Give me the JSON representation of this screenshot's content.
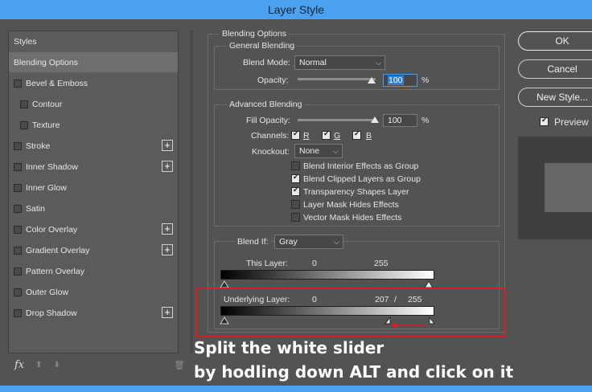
{
  "window": {
    "title": "Layer Style"
  },
  "styles_panel": {
    "items": [
      {
        "label": "Styles",
        "checkbox": false,
        "plus": false,
        "active": false,
        "indent": false
      },
      {
        "label": "Blending Options",
        "checkbox": false,
        "plus": false,
        "active": true,
        "indent": false
      },
      {
        "label": "Bevel & Emboss",
        "checkbox": true,
        "plus": false,
        "active": false,
        "indent": false
      },
      {
        "label": "Contour",
        "checkbox": true,
        "plus": false,
        "active": false,
        "indent": true
      },
      {
        "label": "Texture",
        "checkbox": true,
        "plus": false,
        "active": false,
        "indent": true
      },
      {
        "label": "Stroke",
        "checkbox": true,
        "plus": true,
        "active": false,
        "indent": false
      },
      {
        "label": "Inner Shadow",
        "checkbox": true,
        "plus": true,
        "active": false,
        "indent": false
      },
      {
        "label": "Inner Glow",
        "checkbox": true,
        "plus": false,
        "active": false,
        "indent": false
      },
      {
        "label": "Satin",
        "checkbox": true,
        "plus": false,
        "active": false,
        "indent": false
      },
      {
        "label": "Color Overlay",
        "checkbox": true,
        "plus": true,
        "active": false,
        "indent": false
      },
      {
        "label": "Gradient Overlay",
        "checkbox": true,
        "plus": true,
        "active": false,
        "indent": false
      },
      {
        "label": "Pattern Overlay",
        "checkbox": true,
        "plus": false,
        "active": false,
        "indent": false
      },
      {
        "label": "Outer Glow",
        "checkbox": true,
        "plus": false,
        "active": false,
        "indent": false
      },
      {
        "label": "Drop Shadow",
        "checkbox": true,
        "plus": true,
        "active": false,
        "indent": false
      }
    ],
    "footer": {
      "fx": "fx",
      "up": "⬆",
      "down": "⬇",
      "trash": "🗑"
    }
  },
  "blending_options": {
    "title": "Blending Options",
    "general": {
      "legend": "General Blending",
      "blend_mode_label": "Blend Mode:",
      "blend_mode_value": "Normal",
      "opacity_label": "Opacity:",
      "opacity_value": "100",
      "opacity_fraction": 1.0,
      "percent": "%"
    },
    "advanced": {
      "legend": "Advanced Blending",
      "fill_opacity_label": "Fill Opacity:",
      "fill_opacity_value": "100",
      "fill_opacity_fraction": 1.0,
      "percent": "%",
      "channels_label": "Channels:",
      "channels": [
        {
          "label": "R",
          "checked": true
        },
        {
          "label": "G",
          "checked": true
        },
        {
          "label": "B",
          "checked": true
        }
      ],
      "knockout_label": "Knockout:",
      "knockout_value": "None",
      "options": [
        {
          "label": "Blend Interior Effects as Group",
          "checked": false
        },
        {
          "label": "Blend Clipped Layers as Group",
          "checked": true
        },
        {
          "label": "Transparency Shapes Layer",
          "checked": true
        },
        {
          "label": "Layer Mask Hides Effects",
          "checked": false
        },
        {
          "label": "Vector Mask Hides Effects",
          "checked": false
        }
      ]
    },
    "blend_if": {
      "label": "Blend If:",
      "value": "Gray",
      "this_layer": {
        "label": "This Layer:",
        "low": "0",
        "high": "255"
      },
      "underlying_layer": {
        "label": "Underlying Layer:",
        "low": "0",
        "split_low": "207",
        "separator": "/",
        "high": "255"
      }
    }
  },
  "buttons": {
    "ok": "OK",
    "cancel": "Cancel",
    "new_style": "New Style...",
    "preview_label": "Preview",
    "preview_checked": true
  },
  "annotation": {
    "line1": "Split the white slider",
    "line2": "by hodling down ALT and click on it",
    "highlight_color": "#d61f26"
  },
  "colors": {
    "title_bar": "#4ca0f0",
    "panel_bg": "#535353",
    "focus": "#2f7fd6"
  }
}
